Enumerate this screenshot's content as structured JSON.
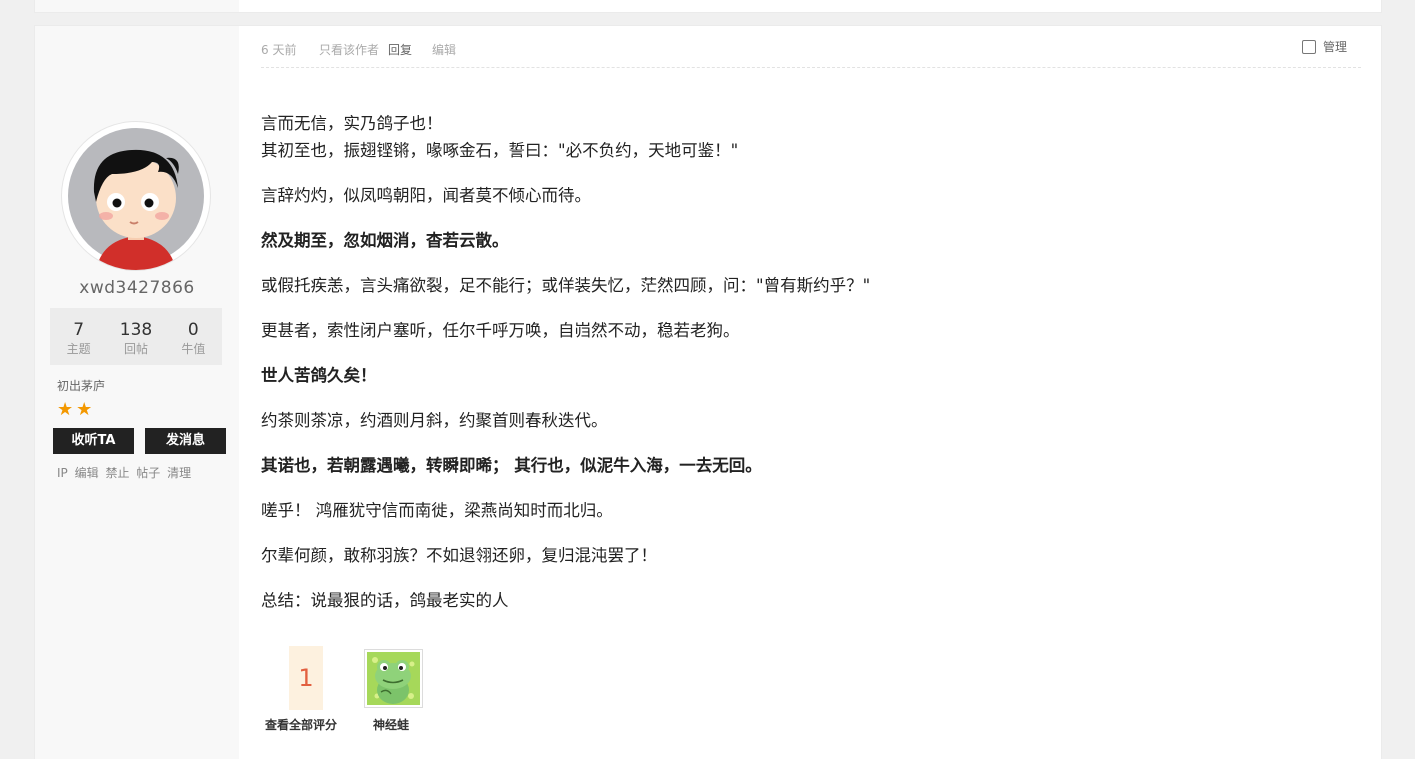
{
  "post": {
    "time": "6 天前",
    "author_only": "只看该作者",
    "reply": "回复",
    "edit": "编辑",
    "manage": "管理"
  },
  "user": {
    "name": "xwd3427866",
    "stats": [
      {
        "num": "7",
        "label": "主题"
      },
      {
        "num": "138",
        "label": "回帖"
      },
      {
        "num": "0",
        "label": "牛值"
      }
    ],
    "rank": "初出茅庐",
    "stars": "★★",
    "star_count": 2,
    "follow_button": "收听TA",
    "message_button": "发消息",
    "admin_links": [
      "IP",
      "编辑",
      "禁止",
      "帖子",
      "清理"
    ]
  },
  "paragraphs": [
    {
      "lines": [
        "言而无信，实乃鸽子也！",
        "其初至也，振翅铿锵，喙啄金石，誓曰：\"必不负约，天地可鉴！\""
      ],
      "bold": false
    },
    {
      "lines": [
        "言辞灼灼，似凤鸣朝阳，闻者莫不倾心而待。"
      ],
      "bold": false
    },
    {
      "lines": [
        "然及期至，忽如烟消，杳若云散。"
      ],
      "bold": true
    },
    {
      "lines": [
        "或假托疾恙，言头痛欲裂，足不能行；或佯装失忆，茫然四顾，问：\"曾有斯约乎？\""
      ],
      "bold": false
    },
    {
      "lines": [
        "更甚者，索性闭户塞听，任尔千呼万唤，自岿然不动，稳若老狗。"
      ],
      "bold": false
    },
    {
      "lines": [
        "世人苦鸽久矣！"
      ],
      "bold": true
    },
    {
      "lines": [
        "约茶则茶凉，约酒则月斜，约聚首则春秋迭代。"
      ],
      "bold": false
    },
    {
      "lines": [
        "其诺也，若朝露遇曦，转瞬即晞； 其行也，似泥牛入海，一去无回。"
      ],
      "bold": true
    },
    {
      "lines": [
        "嗟乎！ 鸿雁犹守信而南徙，梁燕尚知时而北归。"
      ],
      "bold": false
    },
    {
      "lines": [
        "尔辈何颜，敢称羽族？不如退翎还卵，复归混沌罢了！"
      ],
      "bold": false
    },
    {
      "lines": [
        "总结：说最狠的话，鸽最老实的人"
      ],
      "bold": false
    }
  ],
  "rating": {
    "count": "1",
    "view_all": "查看全部评分",
    "rater_name": "神经蛙"
  },
  "colors": {
    "accent": "#f39800",
    "rating_bg": "#fdf1df",
    "rating_num": "#e26040"
  }
}
